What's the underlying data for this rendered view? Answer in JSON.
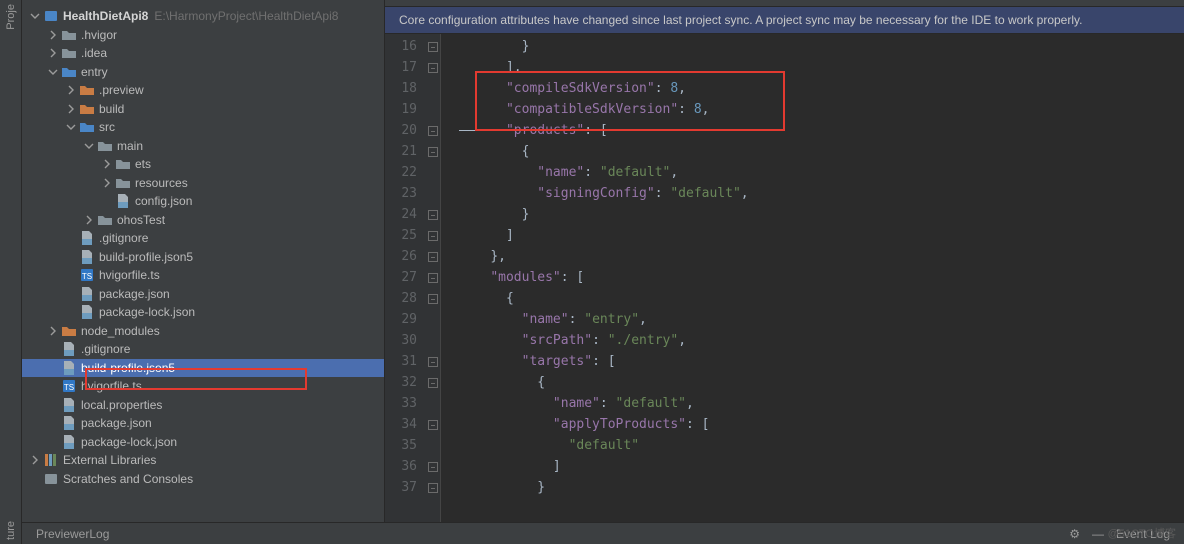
{
  "leftBar": {
    "top": "Proje",
    "bottom": "ture"
  },
  "project": {
    "root": "HealthDietApi8",
    "rootHint": "E:\\HarmonyProject\\HealthDietApi8",
    "items": [
      {
        "indent": 1,
        "arrow": "right",
        "iconType": "folder",
        "label": ".hvigor"
      },
      {
        "indent": 1,
        "arrow": "right",
        "iconType": "folder",
        "label": ".idea"
      },
      {
        "indent": 1,
        "arrow": "down",
        "iconType": "folder-blue",
        "label": "entry"
      },
      {
        "indent": 2,
        "arrow": "right",
        "iconType": "folder-orange",
        "label": ".preview"
      },
      {
        "indent": 2,
        "arrow": "right",
        "iconType": "folder-orange",
        "label": "build"
      },
      {
        "indent": 2,
        "arrow": "down",
        "iconType": "folder-blue",
        "label": "src"
      },
      {
        "indent": 3,
        "arrow": "down",
        "iconType": "folder",
        "label": "main"
      },
      {
        "indent": 4,
        "arrow": "right",
        "iconType": "folder",
        "label": "ets"
      },
      {
        "indent": 4,
        "arrow": "right",
        "iconType": "folder",
        "label": "resources"
      },
      {
        "indent": 4,
        "arrow": "none",
        "iconType": "file",
        "label": "config.json"
      },
      {
        "indent": 3,
        "arrow": "right",
        "iconType": "folder",
        "label": "ohosTest"
      },
      {
        "indent": 2,
        "arrow": "none",
        "iconType": "file",
        "label": ".gitignore"
      },
      {
        "indent": 2,
        "arrow": "none",
        "iconType": "file",
        "label": "build-profile.json5"
      },
      {
        "indent": 2,
        "arrow": "none",
        "iconType": "file-ts",
        "label": "hvigorfile.ts"
      },
      {
        "indent": 2,
        "arrow": "none",
        "iconType": "file",
        "label": "package.json"
      },
      {
        "indent": 2,
        "arrow": "none",
        "iconType": "file",
        "label": "package-lock.json"
      },
      {
        "indent": 1,
        "arrow": "right",
        "iconType": "folder-orange",
        "label": "node_modules"
      },
      {
        "indent": 1,
        "arrow": "none",
        "iconType": "file",
        "label": ".gitignore"
      },
      {
        "indent": 1,
        "arrow": "none",
        "iconType": "file",
        "label": "build-profile.json5",
        "selected": true
      },
      {
        "indent": 1,
        "arrow": "none",
        "iconType": "file-ts",
        "label": "hvigorfile.ts"
      },
      {
        "indent": 1,
        "arrow": "none",
        "iconType": "file",
        "label": "local.properties"
      },
      {
        "indent": 1,
        "arrow": "none",
        "iconType": "file",
        "label": "package.json"
      },
      {
        "indent": 1,
        "arrow": "none",
        "iconType": "file",
        "label": "package-lock.json"
      }
    ],
    "externalLibs": "External Libraries",
    "scratches": "Scratches and Consoles"
  },
  "banner": "Core configuration attributes have changed since last project sync. A project sync may be necessary for the IDE to work properly.",
  "code": {
    "startLine": 16,
    "lines": [
      {
        "t": "        }"
      },
      {
        "t": "      ],"
      },
      {
        "t": "      \"compileSdkVersion\": 8,",
        "hl": true
      },
      {
        "t": "      \"compatibleSdkVersion\": 8,",
        "hl": true
      },
      {
        "t": "      \"products\": [",
        "strike": true
      },
      {
        "t": "        {"
      },
      {
        "t": "          \"name\": \"default\","
      },
      {
        "t": "          \"signingConfig\": \"default\","
      },
      {
        "t": "        }"
      },
      {
        "t": "      ]"
      },
      {
        "t": "    },"
      },
      {
        "t": "    \"modules\": ["
      },
      {
        "t": "      {"
      },
      {
        "t": "        \"name\": \"entry\","
      },
      {
        "t": "        \"srcPath\": \"./entry\","
      },
      {
        "t": "        \"targets\": ["
      },
      {
        "t": "          {"
      },
      {
        "t": "            \"name\": \"default\","
      },
      {
        "t": "            \"applyToProducts\": ["
      },
      {
        "t": "              \"default\""
      },
      {
        "t": "            ]"
      },
      {
        "t": "          }"
      }
    ]
  },
  "status": {
    "left": "PreviewerLog",
    "event": "Event Log",
    "gear": "⚙",
    "minus": "—"
  },
  "watermark": "@51CTO博客"
}
